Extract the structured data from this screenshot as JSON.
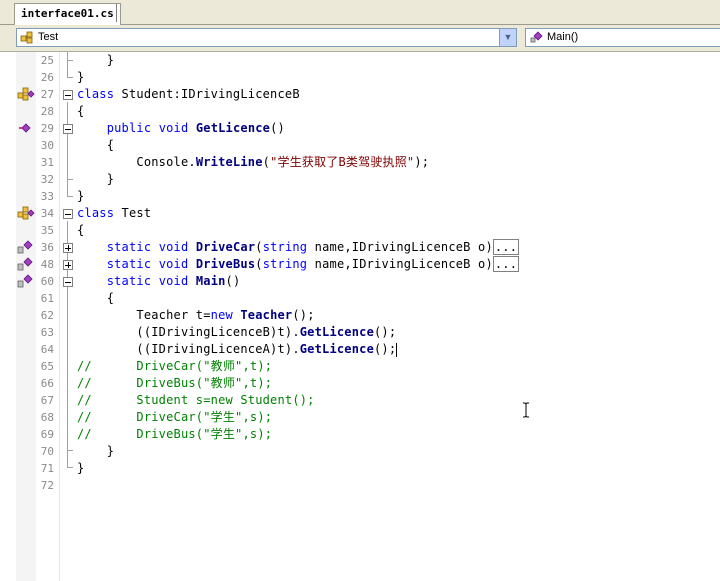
{
  "tab": {
    "label": "interface01.cs"
  },
  "nav": {
    "left_combo": "Test",
    "right_combo": "Main()"
  },
  "lines": [
    {
      "num": "25",
      "text": "    }"
    },
    {
      "num": "26",
      "text": "}"
    },
    {
      "num": "27",
      "text": "class Student:IDrivingLicenceB"
    },
    {
      "num": "28",
      "text": "{"
    },
    {
      "num": "29",
      "text": "    public void GetLicence()"
    },
    {
      "num": "30",
      "text": "    {"
    },
    {
      "num": "31",
      "text": "        Console.WriteLine(\"学生获取了B类驾驶执照\");"
    },
    {
      "num": "32",
      "text": "    }"
    },
    {
      "num": "33",
      "text": "}"
    },
    {
      "num": "34",
      "text": "class Test"
    },
    {
      "num": "35",
      "text": "{"
    },
    {
      "num": "36",
      "text": "    static void DriveCar(string name,IDrivingLicenceB o)..."
    },
    {
      "num": "48",
      "text": "    static void DriveBus(string name,IDrivingLicenceB o)..."
    },
    {
      "num": "60",
      "text": "    static void Main()"
    },
    {
      "num": "61",
      "text": "    {"
    },
    {
      "num": "62",
      "text": "        Teacher t=new Teacher();"
    },
    {
      "num": "63",
      "text": "        ((IDrivingLicenceB)t).GetLicence();"
    },
    {
      "num": "64",
      "text": "        ((IDrivingLicenceA)t).GetLicence();"
    },
    {
      "num": "65",
      "text": "//      DriveCar(\"教师\",t);"
    },
    {
      "num": "66",
      "text": "//      DriveBus(\"教师\",t);"
    },
    {
      "num": "67",
      "text": "//      Student s=new Student();"
    },
    {
      "num": "68",
      "text": "//      DriveCar(\"学生\",s);"
    },
    {
      "num": "69",
      "text": "//      DriveBus(\"学生\",s);"
    },
    {
      "num": "70",
      "text": "    }"
    },
    {
      "num": "71",
      "text": "}"
    },
    {
      "num": "72",
      "text": ""
    }
  ],
  "tokens": {
    "close_brace": "}",
    "open_brace": "{",
    "kw_class": "class",
    "kw_public": "public",
    "kw_void": "void",
    "kw_static": "static",
    "kw_string": "string",
    "kw_new": "new",
    "student_decl": " Student:IDrivingLicenceB",
    "test_decl": " Test",
    "get_licence": "GetLicence",
    "parens": "()",
    "console": "Console.",
    "write_line": "WriteLine",
    "open_paren": "(",
    "str_student_b": "\"学生获取了B类驾驶执照\"",
    "close_semicolon": ");",
    "drive_car": "DriveCar",
    "drive_bus": "DriveBus",
    "main": "Main",
    "params_name": " name,IDrivingLicenceB o)",
    "collapsed": "...",
    "teacher_t": "Teacher t=",
    "teacher": "Teacher",
    "call_end": "();",
    "cast_b": "((IDrivingLicenceB)t).",
    "cast_a": "((IDrivingLicenceA)t).",
    "c65": "//      DriveCar(\"教师\",t);",
    "c66": "//      DriveBus(\"教师\",t);",
    "c67": "//      Student s=new Student();",
    "c68": "//      DriveCar(\"学生\",s);",
    "c69": "//      DriveBus(\"学生\",s);"
  },
  "colors": {
    "keyword": "#0000ff",
    "comment": "#008000",
    "string": "#800000",
    "identifier_bold": "#000080"
  }
}
